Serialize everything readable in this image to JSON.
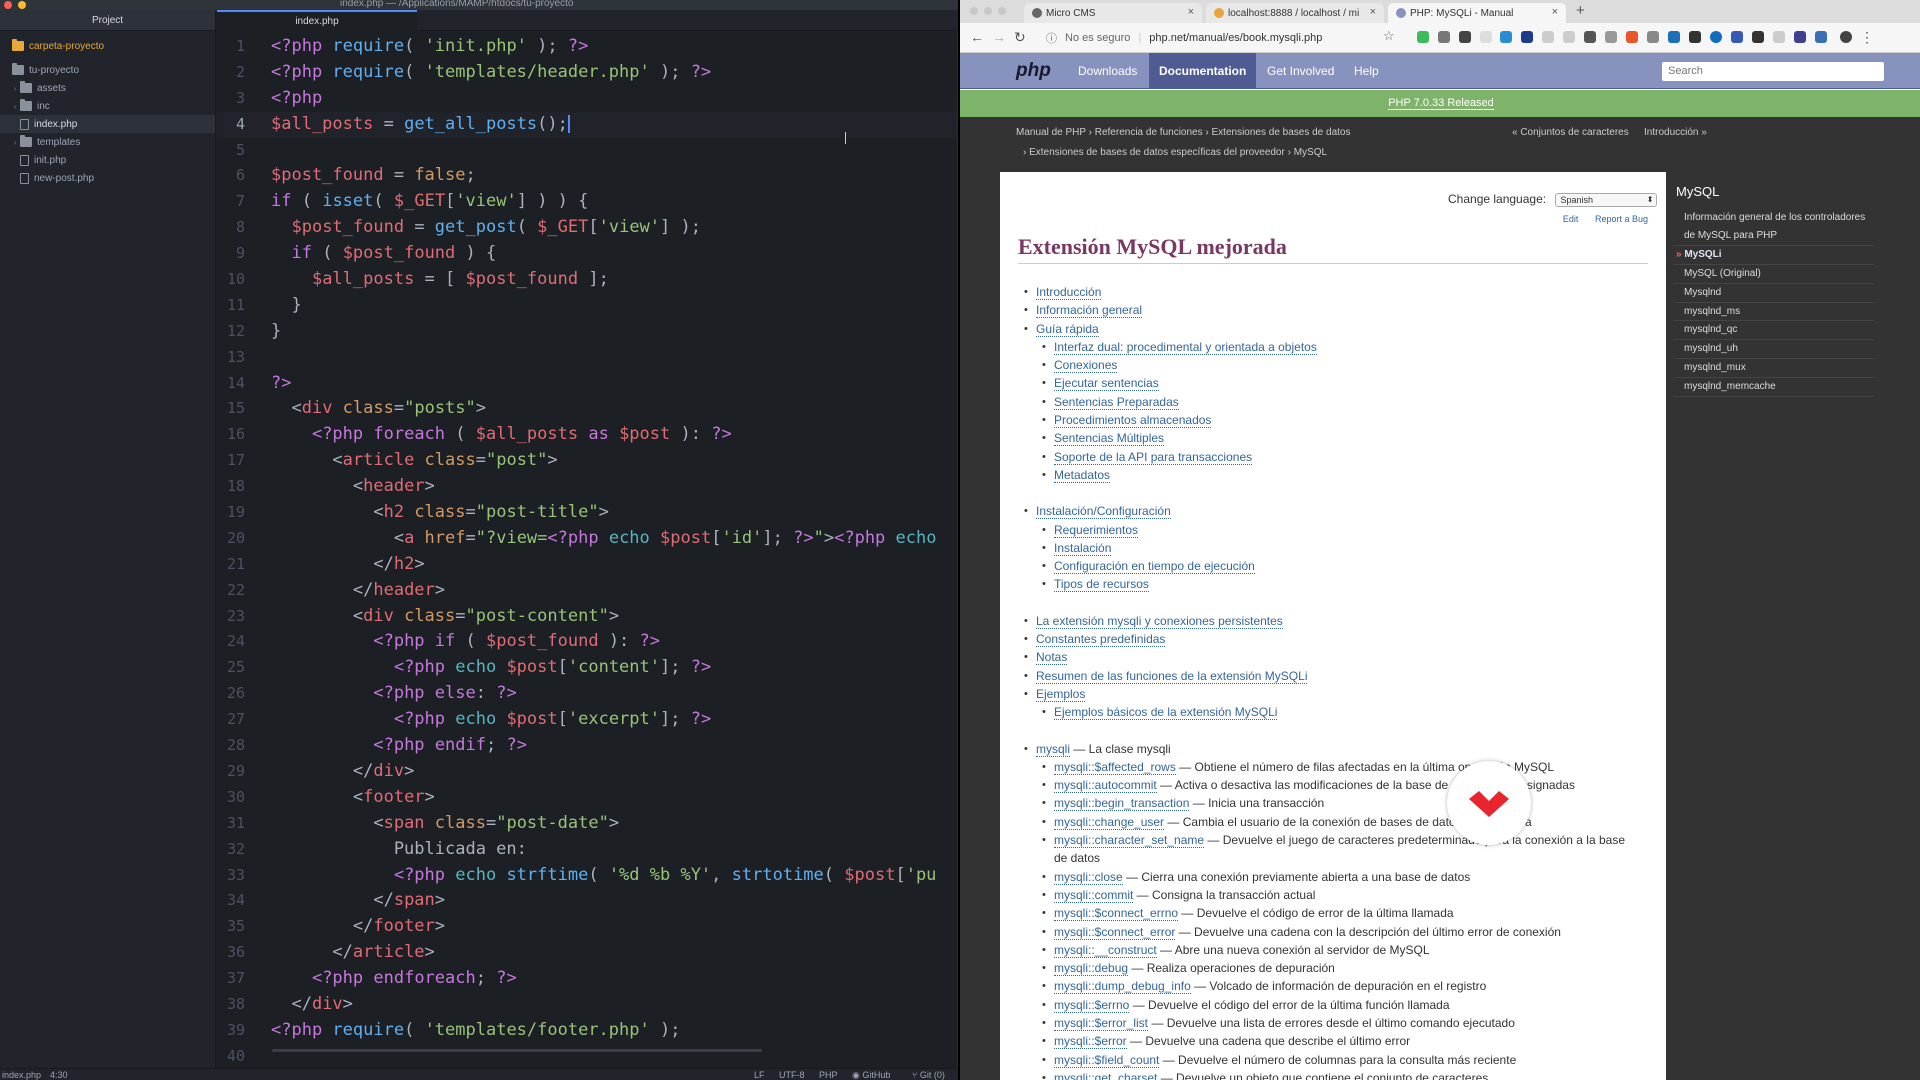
{
  "editor": {
    "window_title": "index.php — /Applications/MAMP/htdocs/tu-proyecto",
    "tree_tab_label": "Project",
    "file_tab_label": "index.php",
    "tree": [
      {
        "label": "carpeta-proyecto",
        "kind": "root",
        "level": 0
      },
      {
        "label": "tu-proyecto",
        "kind": "folder-open",
        "level": 0
      },
      {
        "label": "assets",
        "kind": "folder",
        "level": 1
      },
      {
        "label": "inc",
        "kind": "folder",
        "level": 1
      },
      {
        "label": "index.php",
        "kind": "file",
        "level": 1,
        "selected": true
      },
      {
        "label": "templates",
        "kind": "folder",
        "level": 1
      },
      {
        "label": "init.php",
        "kind": "file",
        "level": 1
      },
      {
        "label": "new-post.php",
        "kind": "file",
        "level": 1
      }
    ],
    "active_line": 4,
    "code": [
      [
        [
          "k",
          "&lt;?php "
        ],
        [
          "f",
          "require"
        ],
        [
          "p",
          "( "
        ],
        [
          "s",
          "'init.php'"
        ],
        [
          "p",
          " ); "
        ],
        [
          "k",
          "?&gt;"
        ]
      ],
      [
        [
          "k",
          "&lt;?php "
        ],
        [
          "f",
          "require"
        ],
        [
          "p",
          "( "
        ],
        [
          "s",
          "'templates/header.php'"
        ],
        [
          "p",
          " ); "
        ],
        [
          "k",
          "?&gt;"
        ]
      ],
      [
        [
          "k",
          "&lt;?php"
        ]
      ],
      [
        [
          "v",
          "$all_posts"
        ],
        [
          "p",
          " = "
        ],
        [
          "f",
          "get_all_posts"
        ],
        [
          "p",
          "();"
        ],
        [
          "cursor",
          ""
        ]
      ],
      [],
      [
        [
          "v",
          "$post_found"
        ],
        [
          "p",
          " = "
        ],
        [
          "n",
          "false"
        ],
        [
          "p",
          ";"
        ]
      ],
      [
        [
          "k",
          "if"
        ],
        [
          "p",
          " ( "
        ],
        [
          "f",
          "isset"
        ],
        [
          "p",
          "( "
        ],
        [
          "v",
          "$_GET"
        ],
        [
          "p",
          "["
        ],
        [
          "s",
          "'view'"
        ],
        [
          "p",
          "] ) ) {"
        ]
      ],
      [
        [
          "p",
          "  "
        ],
        [
          "v",
          "$post_found"
        ],
        [
          "p",
          " = "
        ],
        [
          "f",
          "get_post"
        ],
        [
          "p",
          "( "
        ],
        [
          "v",
          "$_GET"
        ],
        [
          "p",
          "["
        ],
        [
          "s",
          "'view'"
        ],
        [
          "p",
          "] );"
        ]
      ],
      [
        [
          "p",
          "  "
        ],
        [
          "k",
          "if"
        ],
        [
          "p",
          " ( "
        ],
        [
          "v",
          "$post_found"
        ],
        [
          "p",
          " ) {"
        ]
      ],
      [
        [
          "p",
          "    "
        ],
        [
          "v",
          "$all_posts"
        ],
        [
          "p",
          " = [ "
        ],
        [
          "v",
          "$post_found"
        ],
        [
          "p",
          " ];"
        ]
      ],
      [
        [
          "p",
          "  }"
        ]
      ],
      [
        [
          "p",
          "}"
        ]
      ],
      [],
      [
        [
          "k",
          "?&gt;"
        ]
      ],
      [
        [
          "p",
          "  &lt;"
        ],
        [
          "t",
          "div"
        ],
        [
          "a",
          " class"
        ],
        [
          "p",
          "="
        ],
        [
          "s",
          "\"posts\""
        ],
        [
          "p",
          "&gt;"
        ]
      ],
      [
        [
          "p",
          "    "
        ],
        [
          "k",
          "&lt;?php "
        ],
        [
          "k",
          "foreach"
        ],
        [
          "p",
          " ( "
        ],
        [
          "v",
          "$all_posts"
        ],
        [
          "k",
          " as "
        ],
        [
          "v",
          "$post"
        ],
        [
          "p",
          " ): "
        ],
        [
          "k",
          "?&gt;"
        ]
      ],
      [
        [
          "p",
          "      &lt;"
        ],
        [
          "t",
          "article"
        ],
        [
          "a",
          " class"
        ],
        [
          "p",
          "="
        ],
        [
          "s",
          "\"post\""
        ],
        [
          "p",
          "&gt;"
        ]
      ],
      [
        [
          "p",
          "        &lt;"
        ],
        [
          "t",
          "header"
        ],
        [
          "p",
          "&gt;"
        ]
      ],
      [
        [
          "p",
          "          &lt;"
        ],
        [
          "t",
          "h2"
        ],
        [
          "a",
          " class"
        ],
        [
          "p",
          "="
        ],
        [
          "s",
          "\"post-title\""
        ],
        [
          "p",
          "&gt;"
        ]
      ],
      [
        [
          "p",
          "            &lt;"
        ],
        [
          "t",
          "a"
        ],
        [
          "a",
          " href"
        ],
        [
          "p",
          "="
        ],
        [
          "s",
          "\"?view="
        ],
        [
          "k",
          "&lt;?php "
        ],
        [
          "c",
          "echo "
        ],
        [
          "v",
          "$post"
        ],
        [
          "p",
          "["
        ],
        [
          "s",
          "'id'"
        ],
        [
          "p",
          "]; "
        ],
        [
          "k",
          "?&gt;"
        ],
        [
          "s",
          "\""
        ],
        [
          "p",
          "&gt;"
        ],
        [
          "k",
          "&lt;?php "
        ],
        [
          "c",
          "echo"
        ]
      ],
      [
        [
          "p",
          "          &lt;/"
        ],
        [
          "t",
          "h2"
        ],
        [
          "p",
          "&gt;"
        ]
      ],
      [
        [
          "p",
          "        &lt;/"
        ],
        [
          "t",
          "header"
        ],
        [
          "p",
          "&gt;"
        ]
      ],
      [
        [
          "p",
          "        &lt;"
        ],
        [
          "t",
          "div"
        ],
        [
          "a",
          " class"
        ],
        [
          "p",
          "="
        ],
        [
          "s",
          "\"post-content\""
        ],
        [
          "p",
          "&gt;"
        ]
      ],
      [
        [
          "p",
          "          "
        ],
        [
          "k",
          "&lt;?php "
        ],
        [
          "k",
          "if"
        ],
        [
          "p",
          " ( "
        ],
        [
          "v",
          "$post_found"
        ],
        [
          "p",
          " ): "
        ],
        [
          "k",
          "?&gt;"
        ]
      ],
      [
        [
          "p",
          "            "
        ],
        [
          "k",
          "&lt;?php "
        ],
        [
          "c",
          "echo "
        ],
        [
          "v",
          "$post"
        ],
        [
          "p",
          "["
        ],
        [
          "s",
          "'content'"
        ],
        [
          "p",
          "]; "
        ],
        [
          "k",
          "?&gt;"
        ]
      ],
      [
        [
          "p",
          "          "
        ],
        [
          "k",
          "&lt;?php "
        ],
        [
          "k",
          "else"
        ],
        [
          "p",
          ": "
        ],
        [
          "k",
          "?&gt;"
        ]
      ],
      [
        [
          "p",
          "            "
        ],
        [
          "k",
          "&lt;?php "
        ],
        [
          "c",
          "echo "
        ],
        [
          "v",
          "$post"
        ],
        [
          "p",
          "["
        ],
        [
          "s",
          "'excerpt'"
        ],
        [
          "p",
          "]; "
        ],
        [
          "k",
          "?&gt;"
        ]
      ],
      [
        [
          "p",
          "          "
        ],
        [
          "k",
          "&lt;?php "
        ],
        [
          "k",
          "endif"
        ],
        [
          "p",
          "; "
        ],
        [
          "k",
          "?&gt;"
        ]
      ],
      [
        [
          "p",
          "        &lt;/"
        ],
        [
          "t",
          "div"
        ],
        [
          "p",
          "&gt;"
        ]
      ],
      [
        [
          "p",
          "        &lt;"
        ],
        [
          "t",
          "footer"
        ],
        [
          "p",
          "&gt;"
        ]
      ],
      [
        [
          "p",
          "          &lt;"
        ],
        [
          "t",
          "span"
        ],
        [
          "a",
          " class"
        ],
        [
          "p",
          "="
        ],
        [
          "s",
          "\"post-date\""
        ],
        [
          "p",
          "&gt;"
        ]
      ],
      [
        [
          "p",
          "            Publicada en:"
        ]
      ],
      [
        [
          "p",
          "            "
        ],
        [
          "k",
          "&lt;?php "
        ],
        [
          "c",
          "echo "
        ],
        [
          "f",
          "strftime"
        ],
        [
          "p",
          "( "
        ],
        [
          "s",
          "'%d %b %Y'"
        ],
        [
          "p",
          ", "
        ],
        [
          "f",
          "strtotime"
        ],
        [
          "p",
          "( "
        ],
        [
          "v",
          "$post"
        ],
        [
          "p",
          "["
        ],
        [
          "s",
          "'pu"
        ]
      ],
      [
        [
          "p",
          "          &lt;/"
        ],
        [
          "t",
          "span"
        ],
        [
          "p",
          "&gt;"
        ]
      ],
      [
        [
          "p",
          "        &lt;/"
        ],
        [
          "t",
          "footer"
        ],
        [
          "p",
          "&gt;"
        ]
      ],
      [
        [
          "p",
          "      &lt;/"
        ],
        [
          "t",
          "article"
        ],
        [
          "p",
          "&gt;"
        ]
      ],
      [
        [
          "p",
          "    "
        ],
        [
          "k",
          "&lt;?php "
        ],
        [
          "k",
          "endforeach"
        ],
        [
          "p",
          "; "
        ],
        [
          "k",
          "?&gt;"
        ]
      ],
      [
        [
          "p",
          "  &lt;/"
        ],
        [
          "t",
          "div"
        ],
        [
          "p",
          "&gt;"
        ]
      ],
      [
        [
          "k",
          "&lt;?php "
        ],
        [
          "f",
          "require"
        ],
        [
          "p",
          "( "
        ],
        [
          "s",
          "'templates/footer.php'"
        ],
        [
          "p",
          " );"
        ]
      ],
      []
    ],
    "status": {
      "file": "index.php",
      "position": "4:30",
      "line_ending": "LF",
      "encoding": "UTF-8",
      "grammar": "PHP",
      "github": "GitHub",
      "git": "Git (0)"
    }
  },
  "browser": {
    "tabs": [
      {
        "label": "Micro CMS",
        "active": false,
        "favicon_color": "#666666"
      },
      {
        "label": "localhost:8888 / localhost / mi",
        "active": false,
        "favicon_color": "#e8a33d"
      },
      {
        "label": "PHP: MySQLi - Manual",
        "active": true,
        "favicon_color": "#8892bf"
      }
    ],
    "security_label": "No es seguro",
    "url": "phpmanual/es/book.mysqli.php",
    "url_display": "php.net/manual/es/book.mysqli.php",
    "site": {
      "logo": "php",
      "nav": [
        "Downloads",
        "Documentation",
        "Get Involved",
        "Help"
      ],
      "current_nav": "Documentation",
      "search_placeholder": "Search",
      "release_banner": "PHP 7.0.33 Released",
      "breadcrumb_line1": [
        "Manual de PHP",
        "Referencia de funciones",
        "Extensiones de bases de datos"
      ],
      "breadcrumb_line2": [
        "Extensiones de bases de datos específicas del proveedor",
        "MySQL"
      ],
      "prev_link": "« Conjuntos de caracteres",
      "next_link": "Introducción »",
      "change_language_label": "Change language:",
      "language_value": "Spanish",
      "edit_label": "Edit",
      "report_bug_label": "Report a Bug",
      "page_title": "Extensión MySQL mejorada",
      "toc": [
        {
          "level": 1,
          "link": "Introducción"
        },
        {
          "level": 1,
          "link": "Información general"
        },
        {
          "level": 1,
          "link": "Guía rápida"
        },
        {
          "level": 2,
          "link": "Interfaz dual: procedimental y orientada a objetos"
        },
        {
          "level": 2,
          "link": "Conexiones"
        },
        {
          "level": 2,
          "link": "Ejecutar sentencias"
        },
        {
          "level": 2,
          "link": "Sentencias Preparadas"
        },
        {
          "level": 2,
          "link": "Procedimientos almacenados"
        },
        {
          "level": 2,
          "link": "Sentencias Múltiples"
        },
        {
          "level": 2,
          "link": "Soporte de la API para transacciones"
        },
        {
          "level": 2,
          "link": "Metadatos"
        },
        {
          "level": 1,
          "link": "Instalación/Configuración",
          "gap": true
        },
        {
          "level": 2,
          "link": "Requerimientos"
        },
        {
          "level": 2,
          "link": "Instalación"
        },
        {
          "level": 2,
          "link": "Configuración en tiempo de ejecución"
        },
        {
          "level": 2,
          "link": "Tipos de recursos"
        },
        {
          "level": 1,
          "link": "La extensión mysqli y conexiones persistentes",
          "gap": true
        },
        {
          "level": 1,
          "link": "Constantes predefinidas"
        },
        {
          "level": 1,
          "link": "Notas"
        },
        {
          "level": 1,
          "link": "Resumen de las funciones de la extensión MySQLi"
        },
        {
          "level": 1,
          "link": "Ejemplos"
        },
        {
          "level": 2,
          "link": "Ejemplos básicos de la extensión MySQLi"
        },
        {
          "level": 1,
          "link": "mysqli",
          "desc": " — La clase mysqli",
          "gap": true
        },
        {
          "level": 2,
          "link": "mysqli::$affected_rows",
          "desc": " — Obtiene el número de filas afectadas en la última operación MySQL"
        },
        {
          "level": 2,
          "link": "mysqli::autocommit",
          "desc": " — Activa o desactiva las modificaciones de la base de datos autoconsignadas"
        },
        {
          "level": 2,
          "link": "mysqli::begin_transaction",
          "desc": " — Inicia una transacción"
        },
        {
          "level": 2,
          "link": "mysqli::change_user",
          "desc": " — Cambia el usuario de la conexión de bases de datos especificada"
        },
        {
          "level": 2,
          "link": "mysqli::character_set_name",
          "desc": " — Devuelve el juego de caracteres predeterminado para la conexión a la base"
        },
        {
          "level": 3,
          "link": "",
          "desc": "de datos"
        },
        {
          "level": 2,
          "link": "mysqli::close",
          "desc": " — Cierra una conexión previamente abierta a una base de datos"
        },
        {
          "level": 2,
          "link": "mysqli::commit",
          "desc": " — Consigna la transacción actual"
        },
        {
          "level": 2,
          "link": "mysqli::$connect_errno",
          "desc": " — Devuelve el código de error de la última llamada"
        },
        {
          "level": 2,
          "link": "mysqli::$connect_error",
          "desc": " — Devuelve una cadena con la descripción del último error de conexión"
        },
        {
          "level": 2,
          "link": "mysqli::__construct",
          "desc": " — Abre una nueva conexión al servidor de MySQL"
        },
        {
          "level": 2,
          "link": "mysqli::debug",
          "desc": " — Realiza operaciones de depuración"
        },
        {
          "level": 2,
          "link": "mysqli::dump_debug_info",
          "desc": " — Volcado de información de depuración en el registro"
        },
        {
          "level": 2,
          "link": "mysqli::$errno",
          "desc": " — Devuelve el código del error de la última función llamada"
        },
        {
          "level": 2,
          "link": "mysqli::$error_list",
          "desc": " — Devuelve una lista de errores desde el último comando ejecutado"
        },
        {
          "level": 2,
          "link": "mysqli::$error",
          "desc": " — Devuelve una cadena que describe el último error"
        },
        {
          "level": 2,
          "link": "mysqli::$field_count",
          "desc": " — Devuelve el número de columnas para la consulta más reciente"
        },
        {
          "level": 2,
          "link": "mysqli::get_charset",
          "desc": " — Devuelve un objeto que contiene el conjunto de caracteres"
        }
      ],
      "sidebar_title": "MySQL",
      "sidebar": [
        {
          "label": "Información general de los controladores de MySQL para PHP",
          "two_line": true
        },
        {
          "label": "MySQLi",
          "current": true
        },
        {
          "label": "MySQL (Original)"
        },
        {
          "label": "Mysqlnd"
        },
        {
          "label": "mysqlnd_ms"
        },
        {
          "label": "mysqlnd_qc"
        },
        {
          "label": "mysqlnd_uh"
        },
        {
          "label": "mysqlnd_mux"
        },
        {
          "label": "mysqlnd_memcache"
        }
      ]
    }
  },
  "colors": {
    "php_purple": "#8892bf",
    "php_dark": "#4f5b93",
    "release_green": "#7eb36a",
    "title_color": "#793862",
    "link_color": "#336699",
    "brand_red": "#e8242e"
  }
}
